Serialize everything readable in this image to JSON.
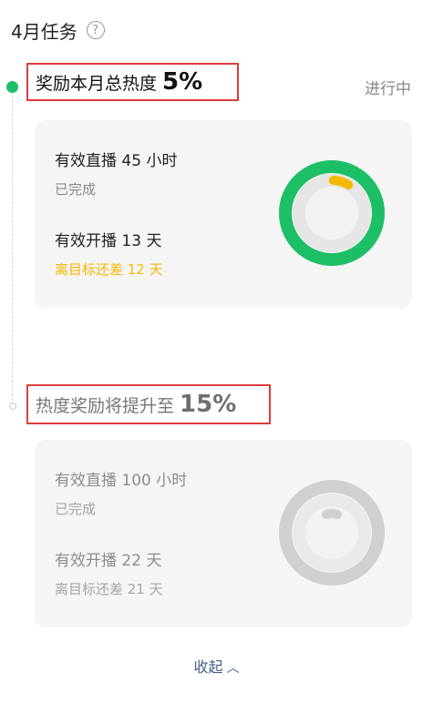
{
  "header": {
    "title": "4月任务",
    "help_glyph": "?"
  },
  "task1": {
    "label": "奖励本月总热度",
    "percent": "5%",
    "status": "进行中",
    "req1_title": "有效直播 45 小时",
    "req1_sub": "已完成",
    "req2_title": "有效开播 13 天",
    "req2_sub": "离目标还差 12 天",
    "progress_fraction": 0.077,
    "ring_color": "#1dbf66",
    "progress_color": "#f5b800"
  },
  "task2": {
    "label": "热度奖励将提升至",
    "percent": "15%",
    "req1_title": "有效直播 100 小时",
    "req1_sub": "已完成",
    "req2_title": "有效开播 22 天",
    "req2_sub": "离目标还差 21 天",
    "progress_fraction": 0.0,
    "ring_color": "#d0d0d0"
  },
  "footer": {
    "collapse_label": "收起",
    "collapse_icon": "chevron-up-icon"
  },
  "colors": {
    "accent": "#1dbf66",
    "highlight_border": "#e03c3c",
    "link": "#44608c"
  }
}
